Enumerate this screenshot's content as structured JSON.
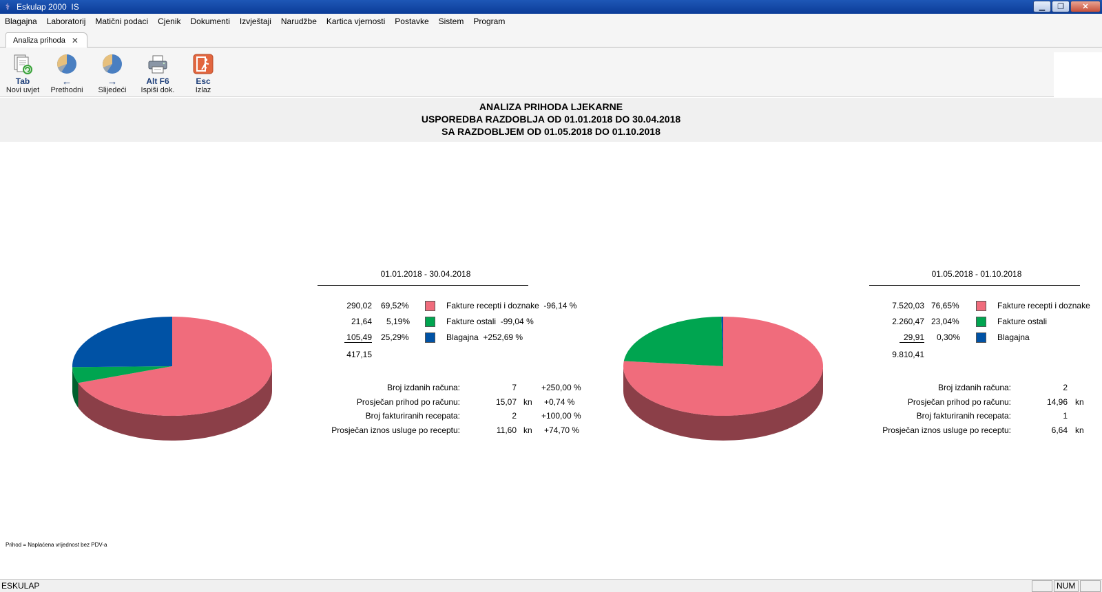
{
  "window": {
    "title": "Eskulap 2000  IS"
  },
  "menu": [
    "Blagajna",
    "Laboratorij",
    "Matični podaci",
    "Cjenik",
    "Dokumenti",
    "Izvještaji",
    "Narudžbe",
    "Kartica vjernosti",
    "Postavke",
    "Sistem",
    "Program"
  ],
  "tab": {
    "label": "Analiza prihoda"
  },
  "toolbar": {
    "new": {
      "key": "Tab",
      "label": "Novi uvjet"
    },
    "prev": {
      "key": "←",
      "label": "Prethodni"
    },
    "next": {
      "key": "→",
      "label": "Slijedeći"
    },
    "print": {
      "key": "Alt F6",
      "label": "Ispiši dok."
    },
    "exit": {
      "key": "Esc",
      "label": "Izlaz"
    }
  },
  "report": {
    "title": "ANALIZA PRIHODA LJEKARNE",
    "line2": "USPOREDBA RAZDOBLJA OD 01.01.2018 DO 30.04.2018",
    "line3": "SA RAZDOBLJEM OD 01.05.2018 DO 01.10.2018"
  },
  "colors": {
    "fakture_recepti": "#f06c7c",
    "fakture_ostali": "#00a550",
    "blagajna": "#0052a5"
  },
  "period1": {
    "label": "01.01.2018 - 30.04.2018",
    "rows": [
      {
        "amount": "290,02",
        "pct": "69,52%",
        "name": "Fakture recepti i doznake",
        "change": "-96,14 %"
      },
      {
        "amount": "21,64",
        "pct": "5,19%",
        "name": "Fakture ostali",
        "change": "-99,04 %"
      },
      {
        "amount": "105,49",
        "pct": "25,29%",
        "name": "Blagajna",
        "change": "+252,69 %"
      }
    ],
    "total": "417,15",
    "shares": [
      69.52,
      5.19,
      25.29
    ],
    "stats": [
      {
        "label": "Broj izdanih računa:",
        "value": "7",
        "unit": "",
        "change": "+250,00 %"
      },
      {
        "label": "Prosječan prihod po računu:",
        "value": "15,07",
        "unit": "kn",
        "change": "+0,74 %"
      },
      {
        "label": "Broj fakturiranih recepata:",
        "value": "2",
        "unit": "",
        "change": "+100,00 %"
      },
      {
        "label": "Prosječan iznos usluge po receptu:",
        "value": "11,60",
        "unit": "kn",
        "change": "+74,70 %"
      }
    ]
  },
  "period2": {
    "label": "01.05.2018 - 01.10.2018",
    "rows": [
      {
        "amount": "7.520,03",
        "pct": "76,65%",
        "name": "Fakture recepti i doznake"
      },
      {
        "amount": "2.260,47",
        "pct": "23,04%",
        "name": "Fakture ostali"
      },
      {
        "amount": "29,91",
        "pct": "0,30%",
        "name": "Blagajna"
      }
    ],
    "total": "9.810,41",
    "shares": [
      76.65,
      23.04,
      0.3
    ],
    "stats": [
      {
        "label": "Broj izdanih računa:",
        "value": "2",
        "unit": ""
      },
      {
        "label": "Prosječan prihod po računu:",
        "value": "14,96",
        "unit": "kn"
      },
      {
        "label": "Broj fakturiranih recepata:",
        "value": "1",
        "unit": ""
      },
      {
        "label": "Prosječan iznos usluge po receptu:",
        "value": "6,64",
        "unit": "kn"
      }
    ]
  },
  "footnote": "Prihod = Naplaćena vrijednost bez PDV-a",
  "status": {
    "text": "ESKULAP",
    "num": "NUM"
  }
}
